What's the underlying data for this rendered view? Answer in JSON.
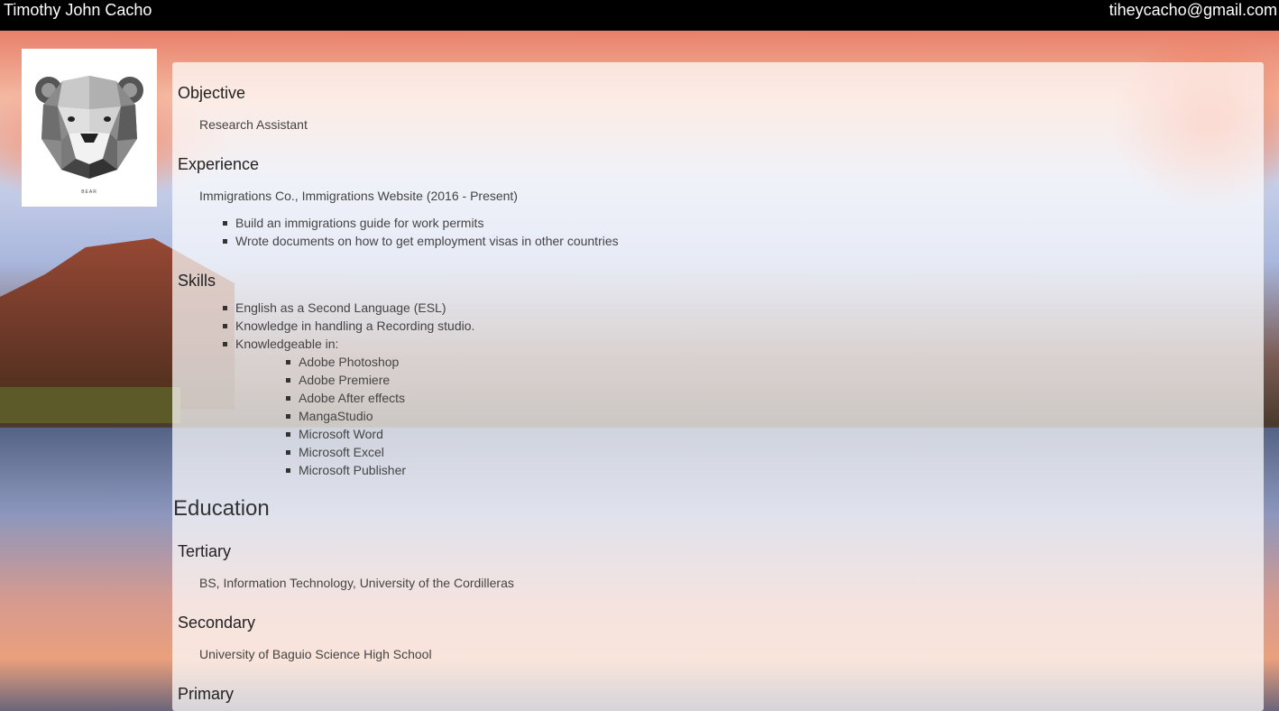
{
  "header": {
    "name": "Timothy John Cacho",
    "email": "tiheycacho@gmail.com"
  },
  "profile": {
    "image_icon": "bear-icon",
    "caption": "BEAR"
  },
  "objective": {
    "heading": "Objective",
    "text": "Research Assistant"
  },
  "experience": {
    "heading": "Experience",
    "job": "Immigrations Co., Immigrations Website (2016 - Present)",
    "items": [
      "Build an immigrations guide for work permits",
      "Wrote documents on how to get employment visas in other countries"
    ]
  },
  "skills": {
    "heading": "Skills",
    "items": [
      "English as a Second Language (ESL)",
      "Knowledge in handling a Recording studio.",
      "Knowledgeable in:"
    ],
    "software": [
      "Adobe Photoshop",
      "Adobe Premiere",
      "Adobe After effects",
      "MangaStudio",
      "Microsoft Word",
      "Microsoft Excel",
      "Microsoft Publisher"
    ]
  },
  "education": {
    "heading": "Education",
    "tertiary": {
      "heading": "Tertiary",
      "text": "BS, Information Technology, University of the Cordilleras"
    },
    "secondary": {
      "heading": "Secondary",
      "text": "University of Baguio Science High School"
    },
    "primary": {
      "heading": "Primary"
    }
  }
}
